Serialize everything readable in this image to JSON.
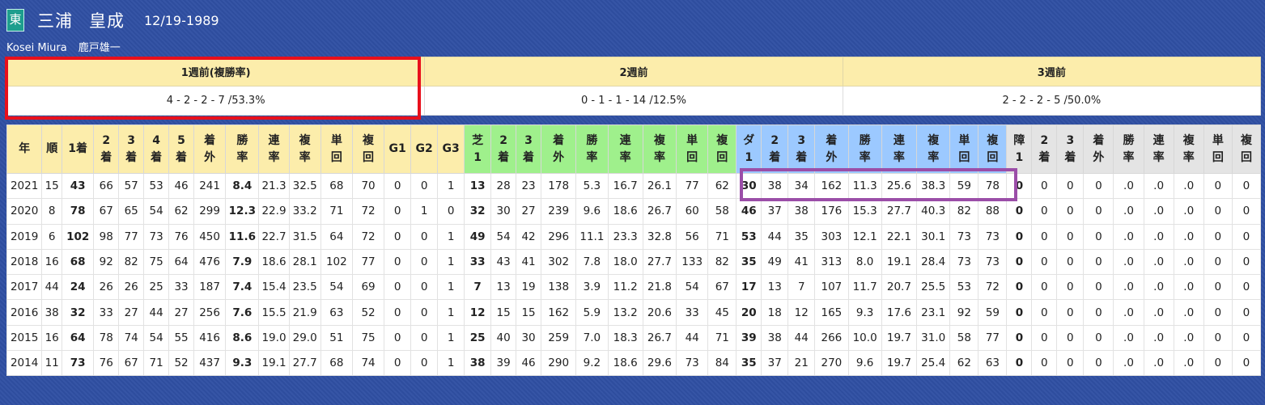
{
  "jockey": {
    "badge": "東",
    "family_name": "三浦",
    "given_name": "皇成",
    "birthdate": "12/19-1989",
    "romaji": "Kosei Miura",
    "master": "鹿戸雄一"
  },
  "weekly": [
    {
      "label": "1週前(複勝率)",
      "value": "4 - 2 - 2 - 7 /53.3%"
    },
    {
      "label": "2週前",
      "value": "0 - 1 - 1 - 14 /12.5%"
    },
    {
      "label": "3週前",
      "value": "2 - 2 - 2 - 5 /50.0%"
    }
  ],
  "stats": {
    "headers": [
      [
        "年",
        "y"
      ],
      [
        "順",
        "y"
      ],
      [
        "1着",
        "y"
      ],
      [
        "2\n着",
        "y"
      ],
      [
        "3\n着",
        "y"
      ],
      [
        "4\n着",
        "y"
      ],
      [
        "5\n着",
        "y"
      ],
      [
        "着\n外",
        "y"
      ],
      [
        "勝\n率",
        "y"
      ],
      [
        "連\n率",
        "y"
      ],
      [
        "複\n率",
        "y"
      ],
      [
        "単\n回",
        "y"
      ],
      [
        "複\n回",
        "y"
      ],
      [
        "G1",
        "y"
      ],
      [
        "G2",
        "y"
      ],
      [
        "G3",
        "y"
      ],
      [
        "芝\n1",
        "g"
      ],
      [
        "2\n着",
        "g"
      ],
      [
        "3\n着",
        "g"
      ],
      [
        "着\n外",
        "g"
      ],
      [
        "勝\n率",
        "g"
      ],
      [
        "連\n率",
        "g"
      ],
      [
        "複\n率",
        "g"
      ],
      [
        "単\n回",
        "g"
      ],
      [
        "複\n回",
        "g"
      ],
      [
        "ダ\n1",
        "b"
      ],
      [
        "2\n着",
        "b"
      ],
      [
        "3\n着",
        "b"
      ],
      [
        "着\n外",
        "b"
      ],
      [
        "勝\n率",
        "b"
      ],
      [
        "連\n率",
        "b"
      ],
      [
        "複\n率",
        "b"
      ],
      [
        "単\n回",
        "b"
      ],
      [
        "複\n回",
        "b"
      ],
      [
        "障\n1",
        "w"
      ],
      [
        "2\n着",
        "w"
      ],
      [
        "3\n着",
        "w"
      ],
      [
        "着\n外",
        "w"
      ],
      [
        "勝\n率",
        "w"
      ],
      [
        "連\n率",
        "w"
      ],
      [
        "複\n率",
        "w"
      ],
      [
        "単\n回",
        "w"
      ],
      [
        "複\n回",
        "w"
      ]
    ],
    "bold_columns": [
      2,
      8,
      16,
      25,
      34
    ],
    "rows": [
      [
        "2021",
        "15",
        "43",
        "66",
        "57",
        "53",
        "46",
        "241",
        "8.4",
        "21.3",
        "32.5",
        "68",
        "70",
        "0",
        "0",
        "1",
        "13",
        "28",
        "23",
        "178",
        "5.3",
        "16.7",
        "26.1",
        "77",
        "62",
        "30",
        "38",
        "34",
        "162",
        "11.3",
        "25.6",
        "38.3",
        "59",
        "78",
        "0",
        "0",
        "0",
        "0",
        ".0",
        ".0",
        ".0",
        "0",
        "0"
      ],
      [
        "2020",
        "8",
        "78",
        "67",
        "65",
        "54",
        "62",
        "299",
        "12.3",
        "22.9",
        "33.2",
        "71",
        "72",
        "0",
        "1",
        "0",
        "32",
        "30",
        "27",
        "239",
        "9.6",
        "18.6",
        "26.7",
        "60",
        "58",
        "46",
        "37",
        "38",
        "176",
        "15.3",
        "27.7",
        "40.3",
        "82",
        "88",
        "0",
        "0",
        "0",
        "0",
        ".0",
        ".0",
        ".0",
        "0",
        "0"
      ],
      [
        "2019",
        "6",
        "102",
        "98",
        "77",
        "73",
        "76",
        "450",
        "11.6",
        "22.7",
        "31.5",
        "64",
        "72",
        "0",
        "0",
        "1",
        "49",
        "54",
        "42",
        "296",
        "11.1",
        "23.3",
        "32.8",
        "56",
        "71",
        "53",
        "44",
        "35",
        "303",
        "12.1",
        "22.1",
        "30.1",
        "73",
        "73",
        "0",
        "0",
        "0",
        "0",
        ".0",
        ".0",
        ".0",
        "0",
        "0"
      ],
      [
        "2018",
        "16",
        "68",
        "92",
        "82",
        "75",
        "64",
        "476",
        "7.9",
        "18.6",
        "28.1",
        "102",
        "77",
        "0",
        "0",
        "1",
        "33",
        "43",
        "41",
        "302",
        "7.8",
        "18.0",
        "27.7",
        "133",
        "82",
        "35",
        "49",
        "41",
        "313",
        "8.0",
        "19.1",
        "28.4",
        "73",
        "73",
        "0",
        "0",
        "0",
        "0",
        ".0",
        ".0",
        ".0",
        "0",
        "0"
      ],
      [
        "2017",
        "44",
        "24",
        "26",
        "26",
        "25",
        "33",
        "187",
        "7.4",
        "15.4",
        "23.5",
        "54",
        "69",
        "0",
        "0",
        "1",
        "7",
        "13",
        "19",
        "138",
        "3.9",
        "11.2",
        "21.8",
        "54",
        "67",
        "17",
        "13",
        "7",
        "107",
        "11.7",
        "20.7",
        "25.5",
        "53",
        "72",
        "0",
        "0",
        "0",
        "0",
        ".0",
        ".0",
        ".0",
        "0",
        "0"
      ],
      [
        "2016",
        "38",
        "32",
        "33",
        "27",
        "44",
        "27",
        "256",
        "7.6",
        "15.5",
        "21.9",
        "63",
        "52",
        "0",
        "0",
        "1",
        "12",
        "15",
        "15",
        "162",
        "5.9",
        "13.2",
        "20.6",
        "33",
        "45",
        "20",
        "18",
        "12",
        "165",
        "9.3",
        "17.6",
        "23.1",
        "92",
        "59",
        "0",
        "0",
        "0",
        "0",
        ".0",
        ".0",
        ".0",
        "0",
        "0"
      ],
      [
        "2015",
        "16",
        "64",
        "78",
        "74",
        "54",
        "55",
        "416",
        "8.6",
        "19.0",
        "29.0",
        "51",
        "75",
        "0",
        "0",
        "1",
        "25",
        "40",
        "30",
        "259",
        "7.0",
        "18.3",
        "26.7",
        "44",
        "71",
        "39",
        "38",
        "44",
        "266",
        "10.0",
        "19.7",
        "31.0",
        "58",
        "77",
        "0",
        "0",
        "0",
        "0",
        ".0",
        ".0",
        ".0",
        "0",
        "0"
      ],
      [
        "2014",
        "11",
        "73",
        "76",
        "67",
        "71",
        "52",
        "437",
        "9.3",
        "19.1",
        "27.7",
        "68",
        "74",
        "0",
        "0",
        "1",
        "38",
        "39",
        "46",
        "290",
        "9.2",
        "18.6",
        "29.6",
        "73",
        "84",
        "35",
        "37",
        "21",
        "270",
        "9.6",
        "19.7",
        "25.4",
        "62",
        "63",
        "0",
        "0",
        "0",
        "0",
        ".0",
        ".0",
        ".0",
        "0",
        "0"
      ]
    ]
  }
}
